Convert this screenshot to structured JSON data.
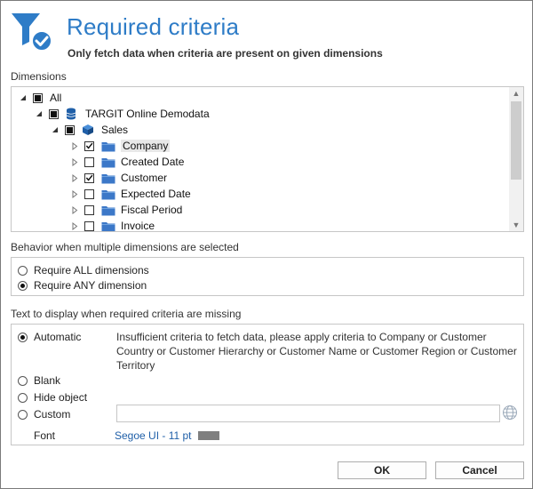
{
  "header": {
    "title": "Required criteria",
    "subtitle": "Only fetch data when criteria are present on given dimensions",
    "icon": "filter-check-icon"
  },
  "dimensions": {
    "label": "Dimensions",
    "tree": [
      {
        "label": "All",
        "level": 0,
        "state": "partial",
        "expander": "expanded",
        "icon": null
      },
      {
        "label": "TARGIT Online Demodata",
        "level": 1,
        "state": "partial",
        "expander": "expanded",
        "icon": "database-icon"
      },
      {
        "label": "Sales",
        "level": 2,
        "state": "partial",
        "expander": "expanded",
        "icon": "cube-icon"
      },
      {
        "label": "Company",
        "level": 3,
        "state": "checked",
        "expander": "collapsed",
        "icon": "folder-icon",
        "selected": true
      },
      {
        "label": "Created Date",
        "level": 3,
        "state": "unchecked",
        "expander": "collapsed",
        "icon": "folder-icon"
      },
      {
        "label": "Customer",
        "level": 3,
        "state": "checked",
        "expander": "collapsed",
        "icon": "folder-icon"
      },
      {
        "label": "Expected Date",
        "level": 3,
        "state": "unchecked",
        "expander": "collapsed",
        "icon": "folder-icon"
      },
      {
        "label": "Fiscal Period",
        "level": 3,
        "state": "unchecked",
        "expander": "collapsed",
        "icon": "folder-icon"
      },
      {
        "label": "Invoice",
        "level": 3,
        "state": "unchecked",
        "expander": "collapsed",
        "icon": "folder-icon"
      }
    ]
  },
  "behavior": {
    "label": "Behavior when multiple dimensions are selected",
    "options": [
      {
        "label": "Require ALL dimensions",
        "selected": false
      },
      {
        "label": "Require ANY dimension",
        "selected": true
      }
    ]
  },
  "missing_text": {
    "label": "Text to display when required criteria are missing",
    "options": [
      {
        "label": "Automatic",
        "selected": true
      },
      {
        "label": "Blank",
        "selected": false
      },
      {
        "label": "Hide object",
        "selected": false
      },
      {
        "label": "Custom",
        "selected": false
      }
    ],
    "automatic_text": "Insufficient criteria to fetch data, please apply criteria to Company or Customer Country or Customer Hierarchy or Customer Name or Customer Region or Customer Territory",
    "custom_value": "",
    "font_label": "Font",
    "font_value": "Segoe UI - 11 pt",
    "font_color": "#7f7f7f"
  },
  "buttons": {
    "ok": "OK",
    "cancel": "Cancel"
  },
  "colors": {
    "accent": "#2e7cc7",
    "folder": "#3c78c8"
  }
}
